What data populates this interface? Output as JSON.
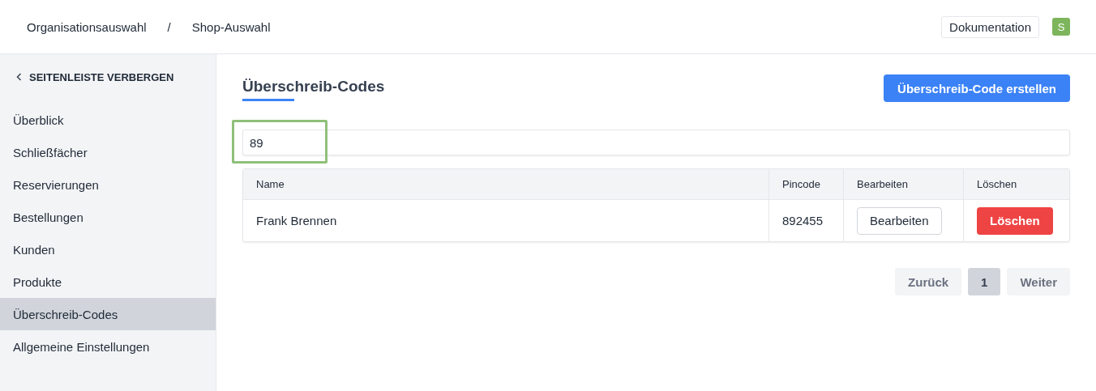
{
  "breadcrumb": [
    "Organisationsauswahl",
    "/",
    "Shop-Auswahl"
  ],
  "header": {
    "docs_button": "Dokumentation",
    "avatar": "S"
  },
  "sidebar": {
    "hide_toggle": "SEITENLEISTE VERBERGEN",
    "items": [
      {
        "label": "Überblick",
        "selected": false
      },
      {
        "label": "Schließfächer",
        "selected": false
      },
      {
        "label": "Reservierungen",
        "selected": false
      },
      {
        "label": "Bestellungen",
        "selected": false
      },
      {
        "label": "Kunden",
        "selected": false
      },
      {
        "label": "Produkte",
        "selected": false
      },
      {
        "label": "Überschreib-Codes",
        "selected": true
      },
      {
        "label": "Allgemeine Einstellungen",
        "selected": false
      }
    ]
  },
  "page": {
    "title": "Überschreib-Codes",
    "create_button": "Überschreib-Code erstellen"
  },
  "search": {
    "value": "89"
  },
  "table": {
    "columns": [
      "Name",
      "Pincode",
      "Bearbeiten",
      "Löschen"
    ],
    "rows": [
      {
        "name": "Frank Brennen",
        "pincode": "892455",
        "edit_button": "Bearbeiten",
        "delete_button": "Löschen"
      }
    ]
  },
  "pagination": {
    "previous": {
      "label": "Zurück",
      "disabled": true
    },
    "pages": [
      {
        "label": "1",
        "selected": true
      }
    ],
    "next": {
      "label": "Weiter",
      "disabled": true
    }
  }
}
